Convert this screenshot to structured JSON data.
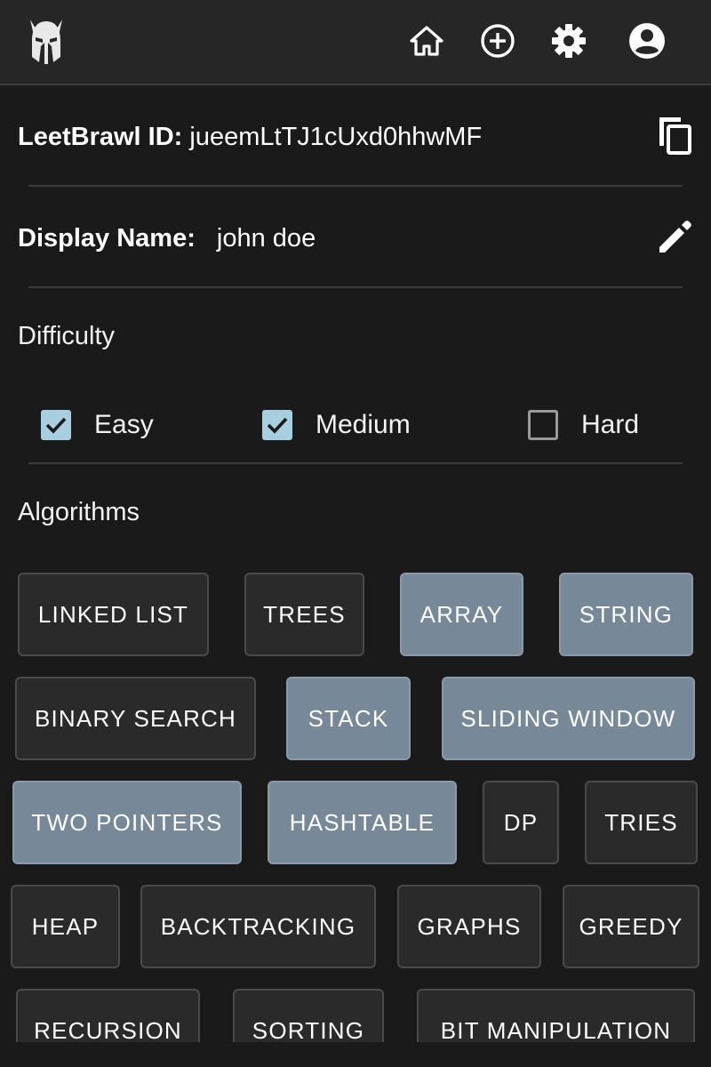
{
  "header": {
    "logo_icon": "spartan-helmet-icon",
    "nav": [
      "home-icon",
      "add-circle-icon",
      "gear-icon",
      "account-circle-icon"
    ]
  },
  "profile": {
    "id_label": "LeetBrawl ID:",
    "id_value": "jueemLtTJ1cUxd0hhwMF",
    "copy_icon": "copy-icon",
    "name_label": "Display Name:",
    "name_value": "john doe",
    "edit_icon": "pencil-icon"
  },
  "difficulty": {
    "title": "Difficulty",
    "options": [
      {
        "label": "Easy",
        "checked": true
      },
      {
        "label": "Medium",
        "checked": true
      },
      {
        "label": "Hard",
        "checked": false
      }
    ]
  },
  "algorithms": {
    "title": "Algorithms",
    "chips": [
      {
        "label": "LINKED LIST",
        "selected": false
      },
      {
        "label": "TREES",
        "selected": false
      },
      {
        "label": "ARRAY",
        "selected": true
      },
      {
        "label": "STRING",
        "selected": true
      },
      {
        "label": "BINARY SEARCH",
        "selected": false
      },
      {
        "label": "STACK",
        "selected": true
      },
      {
        "label": "SLIDING WINDOW",
        "selected": true
      },
      {
        "label": "TWO POINTERS",
        "selected": true
      },
      {
        "label": "HASHTABLE",
        "selected": true
      },
      {
        "label": "DP",
        "selected": false
      },
      {
        "label": "TRIES",
        "selected": false
      },
      {
        "label": "HEAP",
        "selected": false
      },
      {
        "label": "BACKTRACKING",
        "selected": false
      },
      {
        "label": "GRAPHS",
        "selected": false
      },
      {
        "label": "GREEDY",
        "selected": false
      },
      {
        "label": "RECURSION",
        "selected": false
      },
      {
        "label": "SORTING",
        "selected": false
      },
      {
        "label": "BIT MANIPULATION",
        "selected": false
      }
    ]
  },
  "colors": {
    "background": "#1a1a1a",
    "header": "#262626",
    "chip_selected": "#778899",
    "chip_default": "#2a2a2a",
    "checkbox_checked": "#a8cfe0"
  }
}
